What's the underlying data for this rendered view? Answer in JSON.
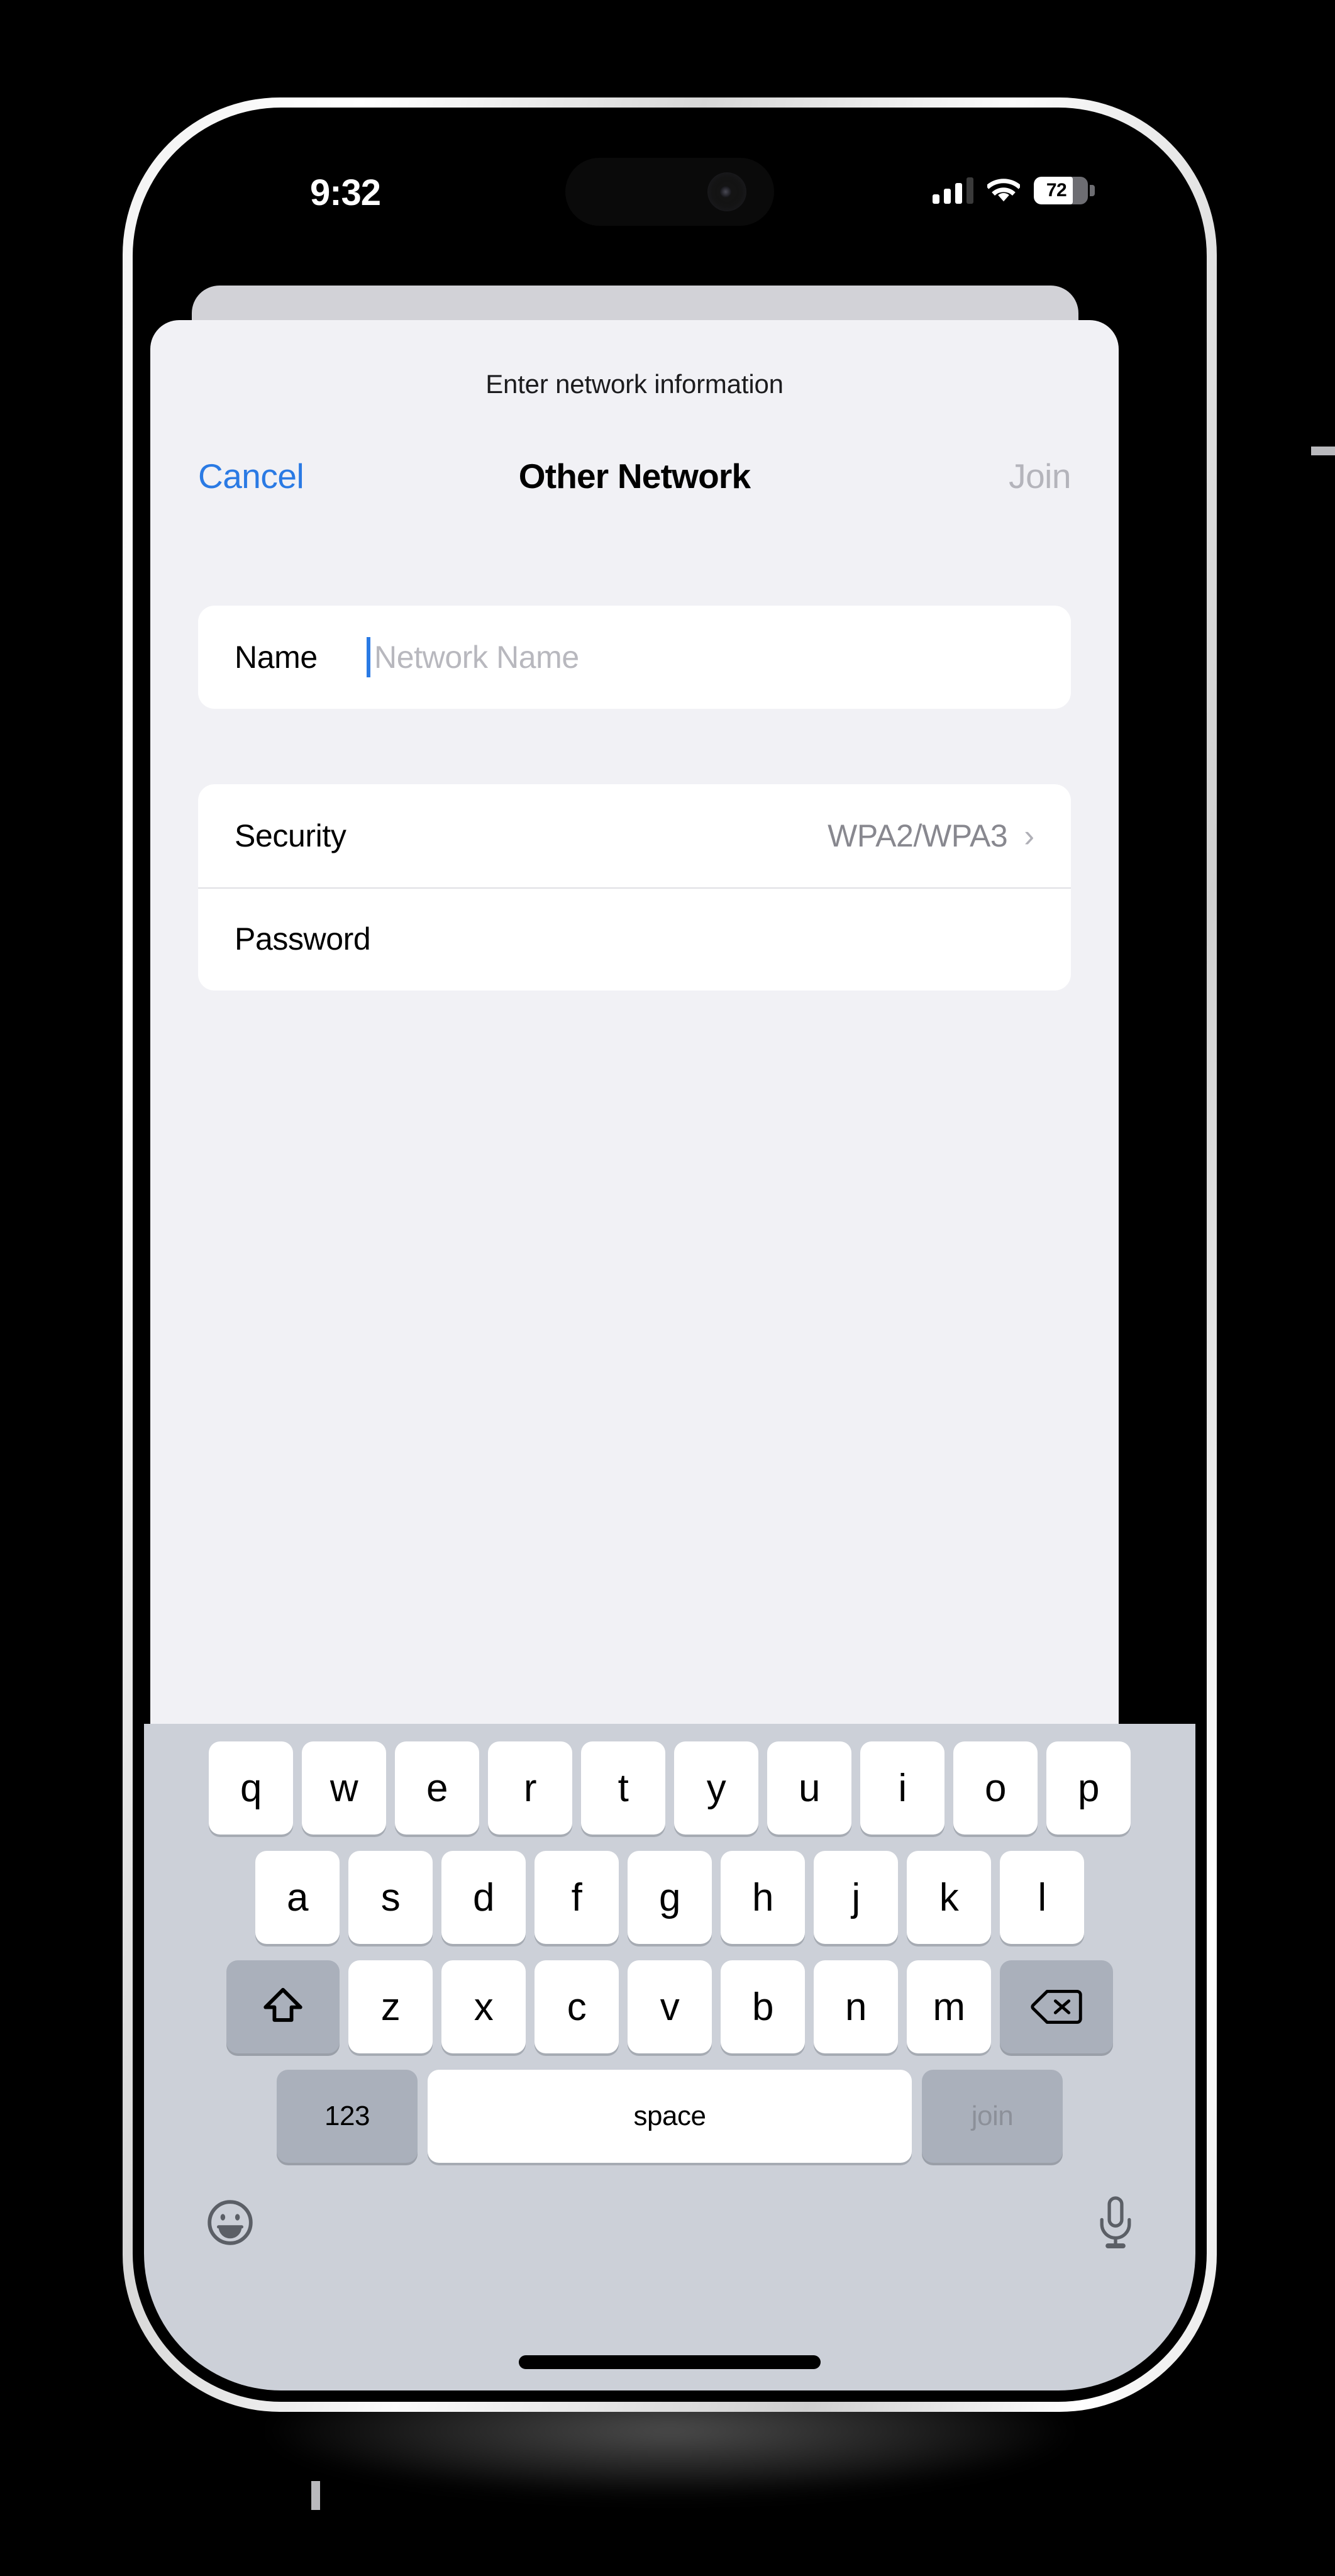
{
  "status_bar": {
    "time": "9:32",
    "battery_level": "72",
    "battery_percent": 72,
    "cellular_icon": "cellular-bars-icon",
    "wifi_icon": "wifi-icon",
    "battery_icon": "battery-icon"
  },
  "sheet": {
    "subtitle": "Enter network information"
  },
  "navbar": {
    "cancel_label": "Cancel",
    "title": "Other Network",
    "join_label": "Join"
  },
  "form": {
    "name_row": {
      "label": "Name",
      "value": "",
      "placeholder": "Network Name"
    },
    "security_row": {
      "label": "Security",
      "value": "WPA2/WPA3",
      "chevron_icon": "chevron-right-icon"
    },
    "password_row": {
      "label": "Password",
      "value": "",
      "placeholder": ""
    }
  },
  "keyboard": {
    "row1": [
      "q",
      "w",
      "e",
      "r",
      "t",
      "y",
      "u",
      "i",
      "o",
      "p"
    ],
    "row2": [
      "a",
      "s",
      "d",
      "f",
      "g",
      "h",
      "j",
      "k",
      "l"
    ],
    "row3": [
      "z",
      "x",
      "c",
      "v",
      "b",
      "n",
      "m"
    ],
    "shift_icon": "shift-arrow-icon",
    "delete_icon": "backspace-delete-icon",
    "numeric_label": "123",
    "space_label": "space",
    "return_label": "join",
    "emoji_icon": "emoji-smiley-icon",
    "dictation_icon": "microphone-icon"
  },
  "colors": {
    "accent_blue": "#2a7ae4",
    "disabled_gray": "#b4b4bb",
    "sheet_background": "#f1f1f5",
    "keyboard_background": "#ccd0d8",
    "key_white": "#ffffff",
    "key_modifier": "#aab0bb"
  }
}
